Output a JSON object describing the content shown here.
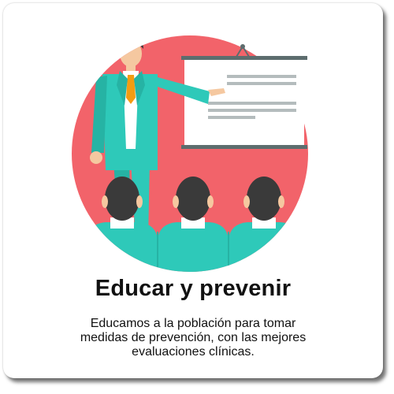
{
  "card": {
    "title": "Educar y prevenir",
    "description": "Educamos a la población para tomar medidas de prevención, con las mejores evaluaciones clínicas."
  },
  "illustration": {
    "subject": "presenter-at-whiteboard-with-audience",
    "colors": {
      "circle": "#f2636a",
      "suit": "#2ec9b9",
      "tie": "#f39c12",
      "hair": "#3a3a3a",
      "skin": "#f5c8a0",
      "board_frame": "#5d6d6e",
      "board_lines": "#b4bcbd"
    }
  }
}
